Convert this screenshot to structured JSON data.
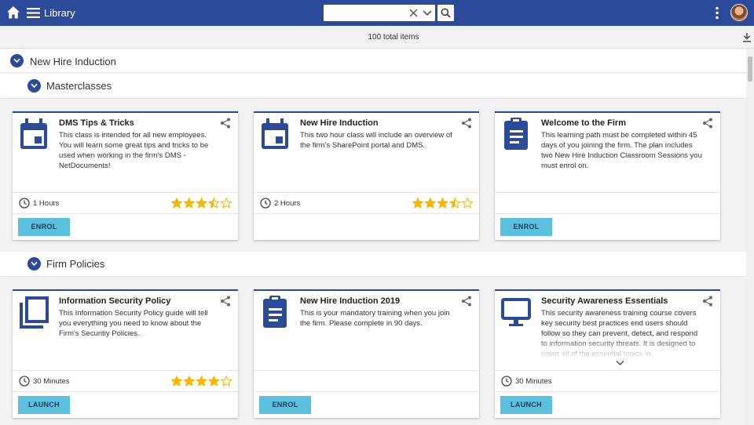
{
  "app": {
    "title": "Library",
    "search_placeholder": "",
    "total_items": "100 total items"
  },
  "colors": {
    "brand": "#2c4a9a",
    "button": "#5bc0de",
    "star": "#f5b800"
  },
  "sections": [
    {
      "label": "New Hire Induction",
      "icon": "chevron-down-icon"
    },
    {
      "label": "Masterclasses",
      "icon": "chevron-down-icon"
    },
    {
      "label": "Firm Policies",
      "icon": "chevron-down-icon"
    }
  ],
  "cards": [
    {
      "title": "DMS Tips & Tricks",
      "description": "This class is intended for all new employees. You will learn some great tips and tricks to be used when working in the firm's DMS - NetDocuments!",
      "icon": "calendar-icon",
      "duration": "1 Hours",
      "rating": 3.5,
      "button": "ENROL"
    },
    {
      "title": "New Hire Induction",
      "description": "This two hour class will include an overview of the firm's SharePoint portal and DMS.",
      "icon": "calendar-icon",
      "duration": "2 Hours",
      "rating": 3.5,
      "button": ""
    },
    {
      "title": "Welcome to the Firm",
      "description": "This learning path must be completed within 45 days of you joining the firm. The plan includes two New Hire Induction Classroom Sessions you must enrol on.",
      "icon": "clipboard-icon",
      "duration": "",
      "rating": null,
      "button": "ENROL"
    },
    {
      "title": "Information Security Policy",
      "description": "This Information Security Policy guide will tell you everything you need to know about the Firm's Securitiy Policies.",
      "icon": "document-stack-icon",
      "duration": "30 Minutes",
      "rating": 4,
      "button": "LAUNCH"
    },
    {
      "title": "New Hire Induction 2019",
      "description": "This is your mandatory training when you join the firm. Please complete in 90 days.",
      "icon": "clipboard-icon",
      "duration": "",
      "rating": null,
      "button": "ENROL"
    },
    {
      "title": "Security Awareness Essentials",
      "description": "This security awareness training course covers key security best practices end users should follow so they can prevent, detect, and respond to information security threats. It is designed to cover all of the essential topics in",
      "icon": "monitor-icon",
      "duration": "30 Minutes",
      "rating": null,
      "button": "LAUNCH"
    }
  ]
}
